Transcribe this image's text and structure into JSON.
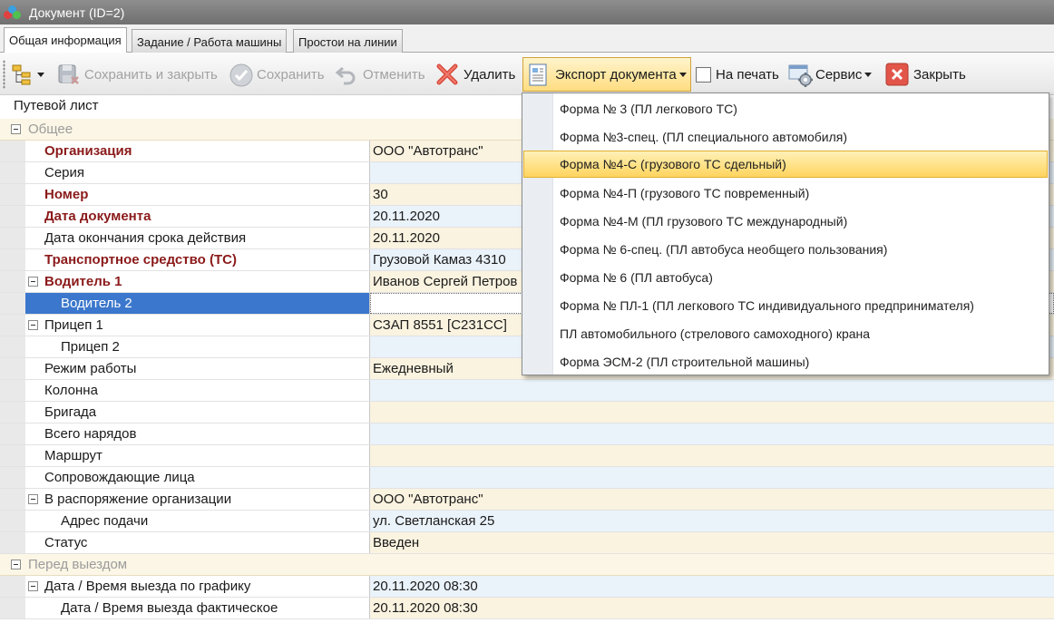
{
  "window": {
    "title": "Документ (ID=2)"
  },
  "tabs": [
    {
      "label": "Общая информация",
      "active": true
    },
    {
      "label": "Задание / Работа машины",
      "active": false
    },
    {
      "label": "Простои на линии",
      "active": false
    }
  ],
  "toolbar": {
    "save_close": "Сохранить и закрыть",
    "save": "Сохранить",
    "cancel": "Отменить",
    "delete": "Удалить",
    "export": "Экспорт документа",
    "print_checkbox": "На печать",
    "print_checked": false,
    "service": "Сервис",
    "close": "Закрыть"
  },
  "export_menu": {
    "items": [
      "Форма № 3 (ПЛ легкового ТС)",
      "Форма №3-спец. (ПЛ специального автомобиля)",
      "Форма №4-С (грузового ТС сдельный)",
      "Форма №4-П (грузового ТС повременный)",
      "Форма №4-М (ПЛ грузового ТС международный)",
      "Форма № 6-спец. (ПЛ автобуса необщего пользования)",
      "Форма № 6 (ПЛ автобуса)",
      "Форма № ПЛ-1 (ПЛ легкового ТС индивидуального предпринимателя)",
      "ПЛ автомобильного (стрелового самоходного) крана",
      "Форма  ЭСМ-2 (ПЛ строительной машины)"
    ],
    "highlighted_index": 2
  },
  "grid": {
    "section_title": "Путевой лист",
    "categories": {
      "general": "Общее",
      "before_departure": "Перед выездом"
    },
    "rows": [
      {
        "name": "Организация",
        "value": "ООО \"Автотранс\""
      },
      {
        "name": "Серия",
        "value": ""
      },
      {
        "name": "Номер",
        "value": "30"
      },
      {
        "name": "Дата документа",
        "value": "20.11.2020"
      },
      {
        "name": "Дата окончания срока действия",
        "value": "20.11.2020"
      },
      {
        "name": "Транспортное средство (ТС)",
        "value": "Грузовой Камаз 4310"
      },
      {
        "name": "Водитель 1",
        "value": "Иванов Сергей Петров"
      },
      {
        "name": "Водитель 2",
        "value": ""
      },
      {
        "name": "Прицеп 1",
        "value": "СЗАП 8551 [С231СС]"
      },
      {
        "name": "Прицеп 2",
        "value": ""
      },
      {
        "name": "Режим работы",
        "value": "Ежедневный"
      },
      {
        "name": "Колонна",
        "value": ""
      },
      {
        "name": "Бригада",
        "value": ""
      },
      {
        "name": "Всего нарядов",
        "value": ""
      },
      {
        "name": "Маршрут",
        "value": ""
      },
      {
        "name": "Сопровождающие лица",
        "value": ""
      },
      {
        "name": "В распоряжение организации",
        "value": "ООО \"Автотранс\""
      },
      {
        "name": "Адрес подачи",
        "value": "ул. Светланская 25"
      },
      {
        "name": "Статус",
        "value": "Введен"
      },
      {
        "name": "Дата / Время выезда по графику",
        "value": "20.11.2020 08:30"
      },
      {
        "name": "Дата / Время выезда фактическое",
        "value": "20.11.2020 08:30"
      }
    ]
  },
  "colors": {
    "required_label": "#8b1a1a",
    "selected_row": "#3b77cc",
    "menu_highlight": "#ffd45e"
  }
}
